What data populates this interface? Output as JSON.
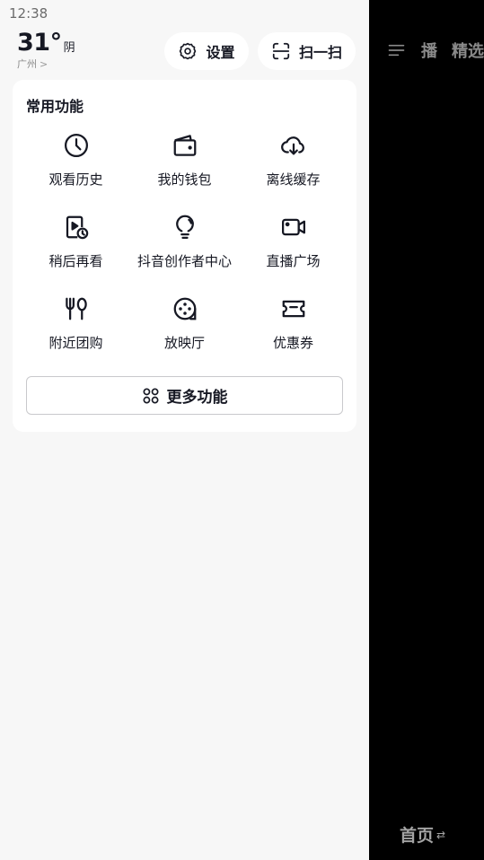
{
  "status_bar": {
    "time": "12:38"
  },
  "weather": {
    "temperature": "31°",
    "condition": "阴",
    "city": "广州",
    "city_chevron": ">"
  },
  "top_actions": {
    "settings_label": "设置",
    "settings_icon": "gear-icon",
    "scan_label": "扫一扫",
    "scan_icon": "scan-icon"
  },
  "common_functions": {
    "title": "常用功能",
    "items": [
      {
        "label": "观看历史",
        "icon": "clock-icon"
      },
      {
        "label": "我的钱包",
        "icon": "wallet-icon"
      },
      {
        "label": "离线缓存",
        "icon": "cloud-download-icon"
      },
      {
        "label": "稍后再看",
        "icon": "watch-later-icon"
      },
      {
        "label": "抖音创作者中心",
        "icon": "bulb-icon"
      },
      {
        "label": "直播广场",
        "icon": "video-camera-icon"
      },
      {
        "label": "附近团购",
        "icon": "fork-spoon-icon"
      },
      {
        "label": "放映厅",
        "icon": "film-reel-icon"
      },
      {
        "label": "优惠券",
        "icon": "ticket-icon"
      }
    ],
    "more_label": "更多功能",
    "more_icon": "grid-icon"
  },
  "background_feed": {
    "tabs": [
      "播",
      "精选"
    ],
    "bottom_tab": "首页",
    "bottom_swap_glyph": "⇄"
  },
  "colors": {
    "drawer_bg": "#f7f7f7",
    "card_bg": "#ffffff",
    "text_primary": "#161823",
    "overlay_bg": "#000000"
  }
}
